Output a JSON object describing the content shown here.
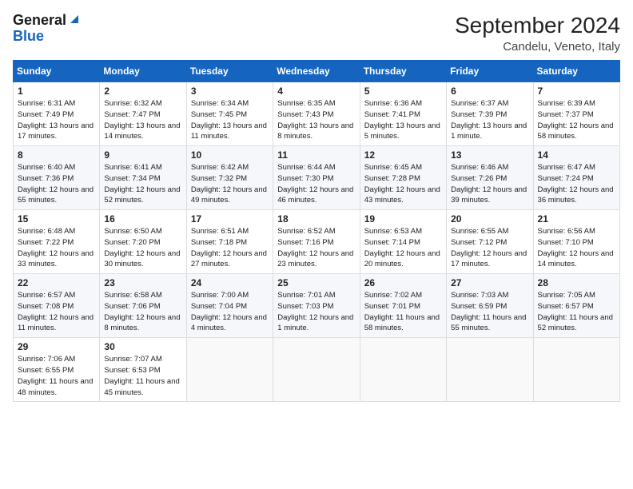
{
  "header": {
    "logo_general": "General",
    "logo_blue": "Blue",
    "month": "September 2024",
    "location": "Candelu, Veneto, Italy"
  },
  "columns": [
    "Sunday",
    "Monday",
    "Tuesday",
    "Wednesday",
    "Thursday",
    "Friday",
    "Saturday"
  ],
  "weeks": [
    [
      {
        "day": "1",
        "sunrise": "Sunrise: 6:31 AM",
        "sunset": "Sunset: 7:49 PM",
        "daylight": "Daylight: 13 hours and 17 minutes."
      },
      {
        "day": "2",
        "sunrise": "Sunrise: 6:32 AM",
        "sunset": "Sunset: 7:47 PM",
        "daylight": "Daylight: 13 hours and 14 minutes."
      },
      {
        "day": "3",
        "sunrise": "Sunrise: 6:34 AM",
        "sunset": "Sunset: 7:45 PM",
        "daylight": "Daylight: 13 hours and 11 minutes."
      },
      {
        "day": "4",
        "sunrise": "Sunrise: 6:35 AM",
        "sunset": "Sunset: 7:43 PM",
        "daylight": "Daylight: 13 hours and 8 minutes."
      },
      {
        "day": "5",
        "sunrise": "Sunrise: 6:36 AM",
        "sunset": "Sunset: 7:41 PM",
        "daylight": "Daylight: 13 hours and 5 minutes."
      },
      {
        "day": "6",
        "sunrise": "Sunrise: 6:37 AM",
        "sunset": "Sunset: 7:39 PM",
        "daylight": "Daylight: 13 hours and 1 minute."
      },
      {
        "day": "7",
        "sunrise": "Sunrise: 6:39 AM",
        "sunset": "Sunset: 7:37 PM",
        "daylight": "Daylight: 12 hours and 58 minutes."
      }
    ],
    [
      {
        "day": "8",
        "sunrise": "Sunrise: 6:40 AM",
        "sunset": "Sunset: 7:36 PM",
        "daylight": "Daylight: 12 hours and 55 minutes."
      },
      {
        "day": "9",
        "sunrise": "Sunrise: 6:41 AM",
        "sunset": "Sunset: 7:34 PM",
        "daylight": "Daylight: 12 hours and 52 minutes."
      },
      {
        "day": "10",
        "sunrise": "Sunrise: 6:42 AM",
        "sunset": "Sunset: 7:32 PM",
        "daylight": "Daylight: 12 hours and 49 minutes."
      },
      {
        "day": "11",
        "sunrise": "Sunrise: 6:44 AM",
        "sunset": "Sunset: 7:30 PM",
        "daylight": "Daylight: 12 hours and 46 minutes."
      },
      {
        "day": "12",
        "sunrise": "Sunrise: 6:45 AM",
        "sunset": "Sunset: 7:28 PM",
        "daylight": "Daylight: 12 hours and 43 minutes."
      },
      {
        "day": "13",
        "sunrise": "Sunrise: 6:46 AM",
        "sunset": "Sunset: 7:26 PM",
        "daylight": "Daylight: 12 hours and 39 minutes."
      },
      {
        "day": "14",
        "sunrise": "Sunrise: 6:47 AM",
        "sunset": "Sunset: 7:24 PM",
        "daylight": "Daylight: 12 hours and 36 minutes."
      }
    ],
    [
      {
        "day": "15",
        "sunrise": "Sunrise: 6:48 AM",
        "sunset": "Sunset: 7:22 PM",
        "daylight": "Daylight: 12 hours and 33 minutes."
      },
      {
        "day": "16",
        "sunrise": "Sunrise: 6:50 AM",
        "sunset": "Sunset: 7:20 PM",
        "daylight": "Daylight: 12 hours and 30 minutes."
      },
      {
        "day": "17",
        "sunrise": "Sunrise: 6:51 AM",
        "sunset": "Sunset: 7:18 PM",
        "daylight": "Daylight: 12 hours and 27 minutes."
      },
      {
        "day": "18",
        "sunrise": "Sunrise: 6:52 AM",
        "sunset": "Sunset: 7:16 PM",
        "daylight": "Daylight: 12 hours and 23 minutes."
      },
      {
        "day": "19",
        "sunrise": "Sunrise: 6:53 AM",
        "sunset": "Sunset: 7:14 PM",
        "daylight": "Daylight: 12 hours and 20 minutes."
      },
      {
        "day": "20",
        "sunrise": "Sunrise: 6:55 AM",
        "sunset": "Sunset: 7:12 PM",
        "daylight": "Daylight: 12 hours and 17 minutes."
      },
      {
        "day": "21",
        "sunrise": "Sunrise: 6:56 AM",
        "sunset": "Sunset: 7:10 PM",
        "daylight": "Daylight: 12 hours and 14 minutes."
      }
    ],
    [
      {
        "day": "22",
        "sunrise": "Sunrise: 6:57 AM",
        "sunset": "Sunset: 7:08 PM",
        "daylight": "Daylight: 12 hours and 11 minutes."
      },
      {
        "day": "23",
        "sunrise": "Sunrise: 6:58 AM",
        "sunset": "Sunset: 7:06 PM",
        "daylight": "Daylight: 12 hours and 8 minutes."
      },
      {
        "day": "24",
        "sunrise": "Sunrise: 7:00 AM",
        "sunset": "Sunset: 7:04 PM",
        "daylight": "Daylight: 12 hours and 4 minutes."
      },
      {
        "day": "25",
        "sunrise": "Sunrise: 7:01 AM",
        "sunset": "Sunset: 7:03 PM",
        "daylight": "Daylight: 12 hours and 1 minute."
      },
      {
        "day": "26",
        "sunrise": "Sunrise: 7:02 AM",
        "sunset": "Sunset: 7:01 PM",
        "daylight": "Daylight: 11 hours and 58 minutes."
      },
      {
        "day": "27",
        "sunrise": "Sunrise: 7:03 AM",
        "sunset": "Sunset: 6:59 PM",
        "daylight": "Daylight: 11 hours and 55 minutes."
      },
      {
        "day": "28",
        "sunrise": "Sunrise: 7:05 AM",
        "sunset": "Sunset: 6:57 PM",
        "daylight": "Daylight: 11 hours and 52 minutes."
      }
    ],
    [
      {
        "day": "29",
        "sunrise": "Sunrise: 7:06 AM",
        "sunset": "Sunset: 6:55 PM",
        "daylight": "Daylight: 11 hours and 48 minutes."
      },
      {
        "day": "30",
        "sunrise": "Sunrise: 7:07 AM",
        "sunset": "Sunset: 6:53 PM",
        "daylight": "Daylight: 11 hours and 45 minutes."
      },
      null,
      null,
      null,
      null,
      null
    ]
  ]
}
